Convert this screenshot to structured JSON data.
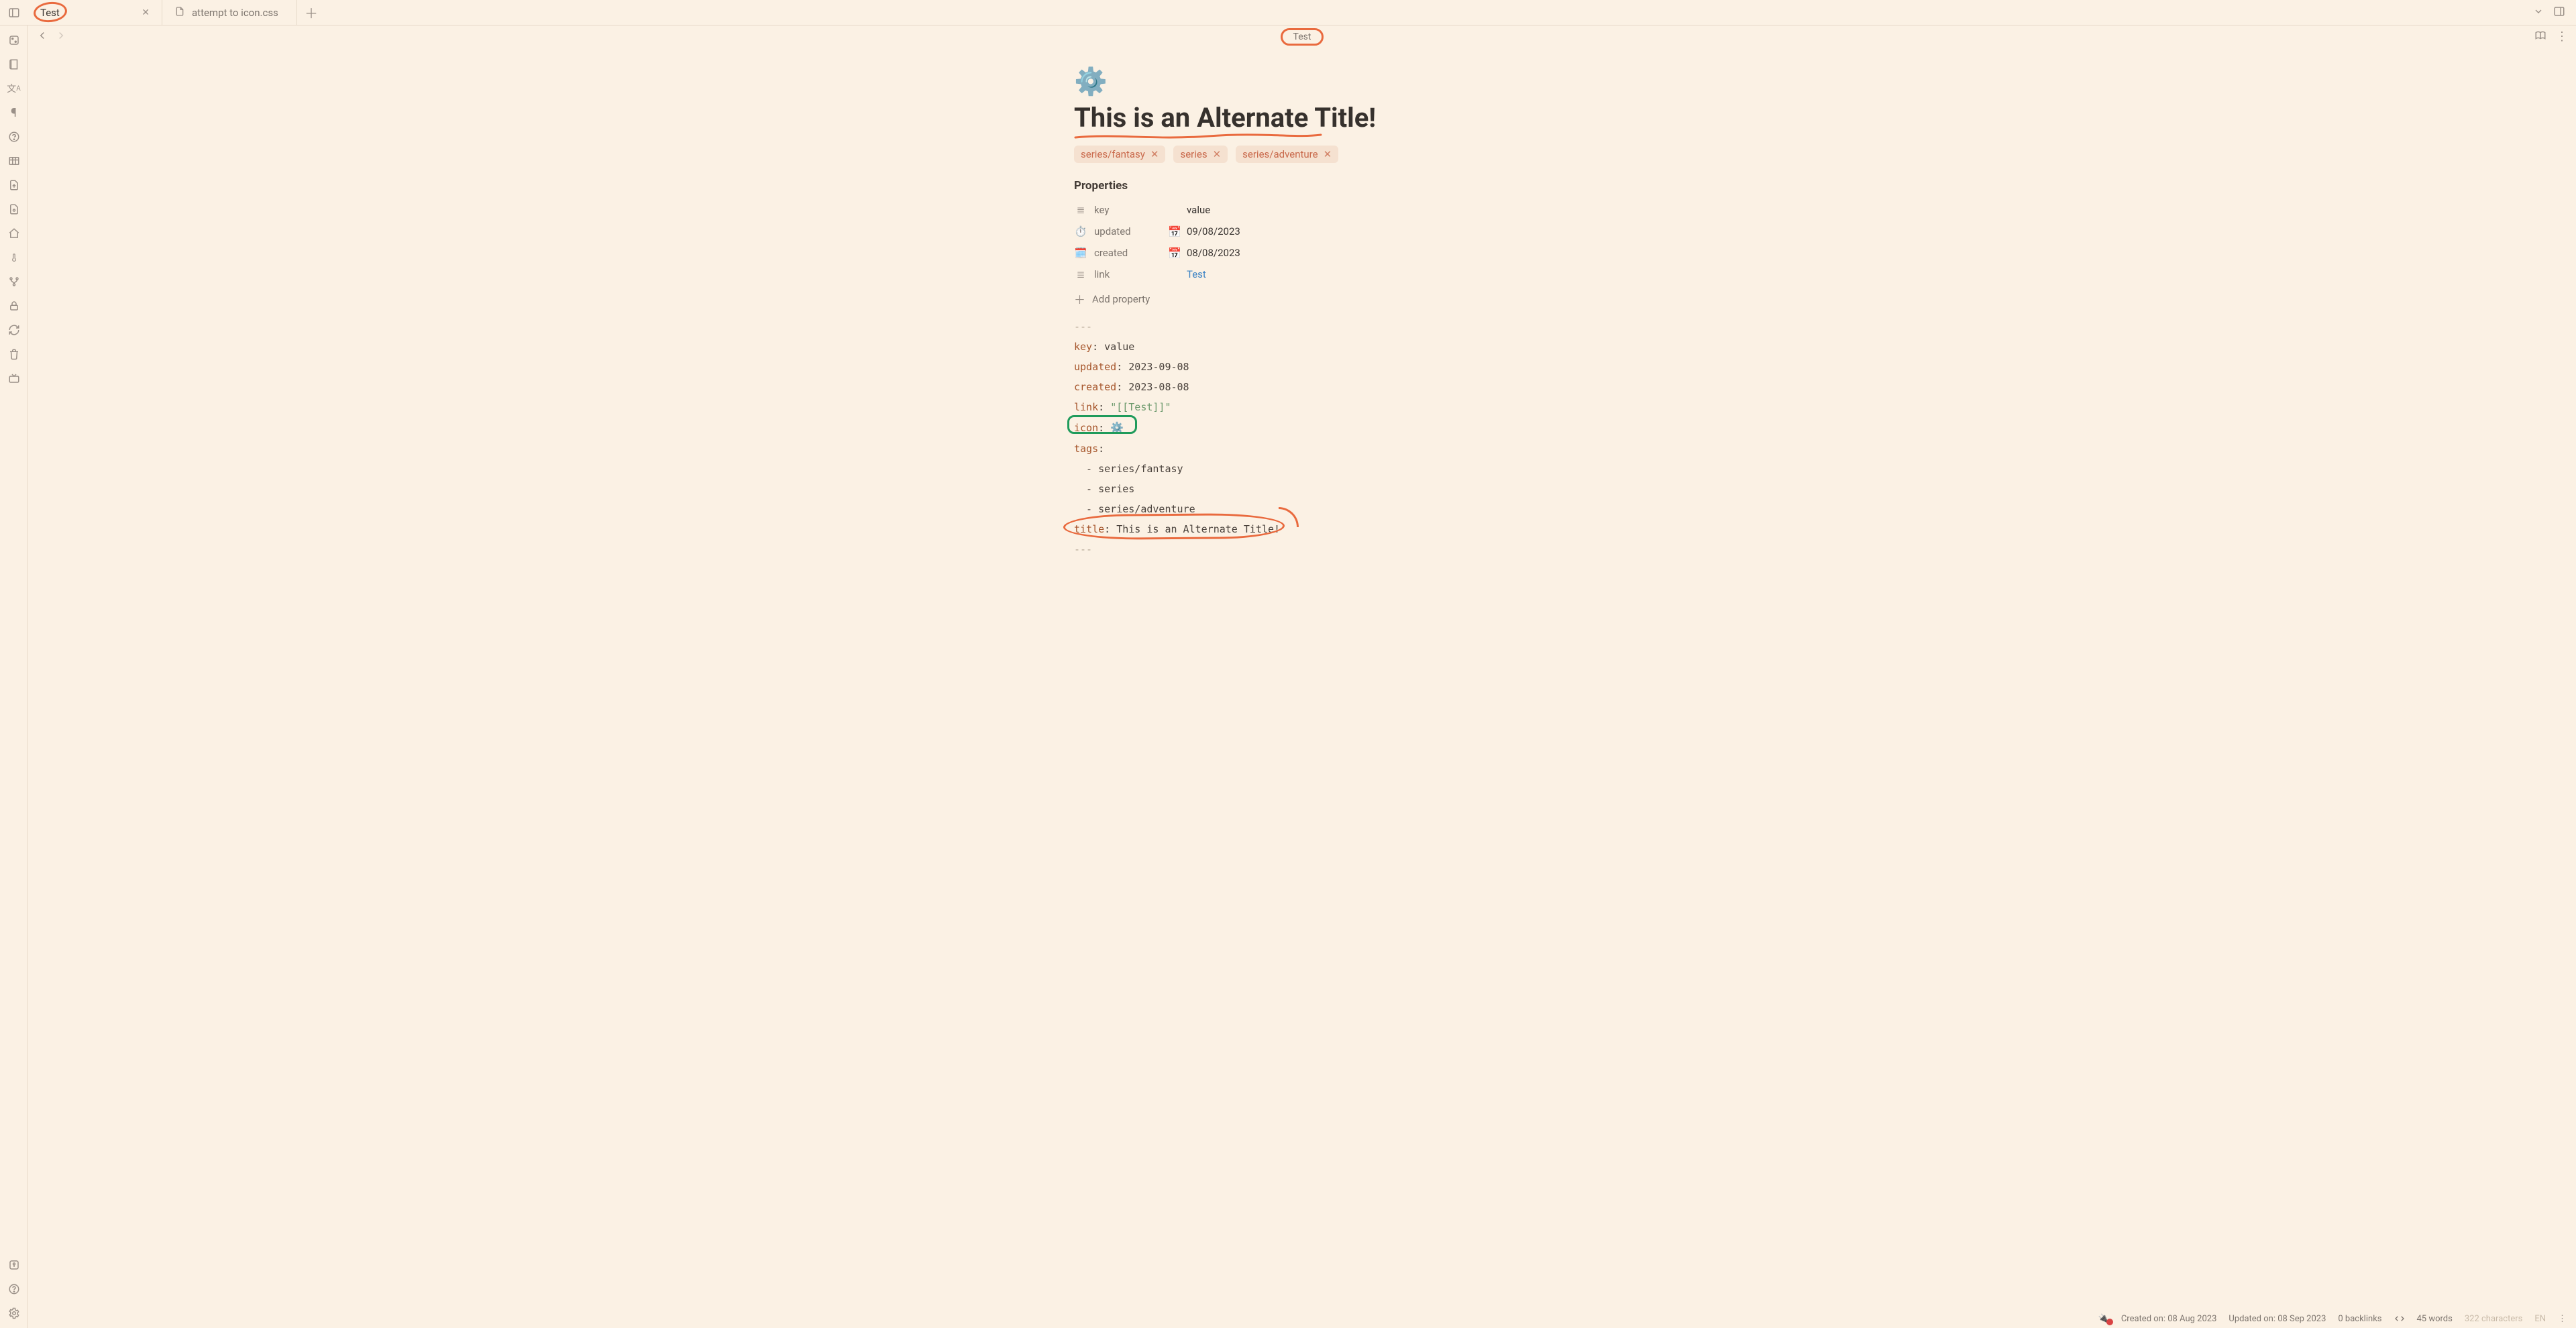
{
  "tabs": [
    {
      "label": "Test",
      "active": true
    },
    {
      "label": "attempt to icon.css",
      "active": false
    }
  ],
  "breadcrumb": "Test",
  "title_icon": "⚙️",
  "note_title": "This is an Alternate Title!",
  "tags": [
    {
      "label": "series/fantasy"
    },
    {
      "label": "series"
    },
    {
      "label": "series/adventure"
    }
  ],
  "properties": {
    "heading": "Properties",
    "rows": [
      {
        "icon": "lines",
        "key": "key",
        "vicon": "",
        "value": "value",
        "type": "text"
      },
      {
        "icon": "clock",
        "key": "updated",
        "vicon": "date",
        "value": "09/08/2023",
        "type": "text"
      },
      {
        "icon": "cal",
        "key": "created",
        "vicon": "date",
        "value": "08/08/2023",
        "type": "text"
      },
      {
        "icon": "lines",
        "key": "link",
        "vicon": "",
        "value": "Test",
        "type": "link"
      }
    ],
    "add_label": "Add property"
  },
  "yaml": {
    "sep": "---",
    "lines": {
      "key_k": "key",
      "key_v": "value",
      "updated_k": "updated",
      "updated_v": "2023-09-08",
      "created_k": "created",
      "created_v": "2023-08-08",
      "link_k": "link",
      "link_v": "\"[[Test]]\"",
      "icon_k": "icon",
      "icon_v": "⚙️",
      "tags_k": "tags",
      "tag0": "series/fantasy",
      "tag1": "series",
      "tag2": "series/adventure",
      "title_k": "title",
      "title_v": "This is an Alternate Title!"
    }
  },
  "statusbar": {
    "created": "Created on: 08 Aug 2023",
    "updated": "Updated on: 08 Sep 2023",
    "backlinks": "0 backlinks",
    "words": "45 words",
    "chars": "322 characters",
    "lang": "EN"
  }
}
